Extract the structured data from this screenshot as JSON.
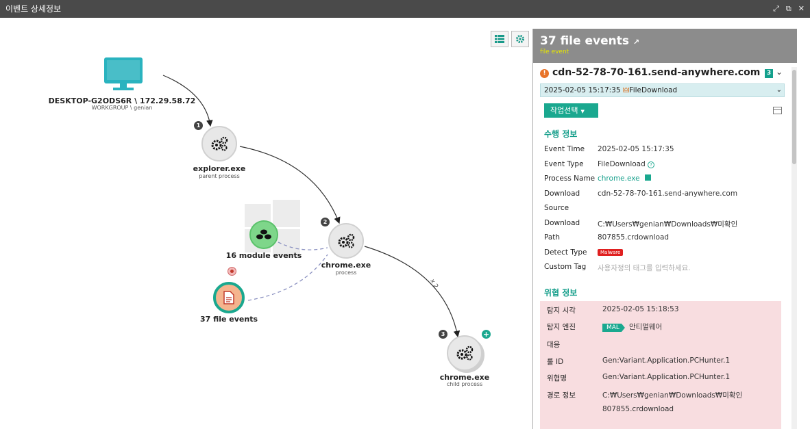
{
  "window": {
    "title": "이벤트 상세정보"
  },
  "graph": {
    "host": {
      "name": "DESKTOP-G2ODS6R \\ 172.29.58.72",
      "sub": "WORKGROUP \\ genian"
    },
    "nodes": [
      {
        "step": "1",
        "name": "explorer.exe",
        "sub": "parent process"
      },
      {
        "step": "2",
        "name": "chrome.exe",
        "sub": "process"
      },
      {
        "step": "3",
        "name": "chrome.exe",
        "sub": "child process"
      }
    ],
    "module_events": "16 module events",
    "file_events": "37 file events",
    "edge_label": "x 2",
    "add_icon": "+"
  },
  "panel": {
    "title": "37 file events",
    "subtitle": "file event",
    "domain": "cdn-52-78-70-161.send-anywhere.com",
    "domain_count": "3",
    "selected_event": "2025-02-05 15:17:35 ",
    "selected_event_type": "FileDownload",
    "action_button": "작업선택",
    "exec_section": "수행 정보",
    "exec": [
      {
        "k": "Event Time",
        "v": "2025-02-05 15:17:35"
      },
      {
        "k": "Event Type",
        "v": "FileDownload"
      },
      {
        "k": "Process Name",
        "v": "chrome.exe"
      },
      {
        "k": "Download",
        "v": "cdn-52-78-70-161.send-anywhere.com"
      },
      {
        "k": "Source",
        "v": ""
      },
      {
        "k": "Download",
        "v": "C:₩Users₩genian₩Downloads₩미확인"
      },
      {
        "k": "Path",
        "v": "807855.crdownload"
      },
      {
        "k": "Detect Type",
        "v": "Malware"
      },
      {
        "k": "Custom Tag",
        "v": "사용자정의 태그를 입력하세요."
      }
    ],
    "threat_section": "위협 정보",
    "threat": [
      {
        "k": "탐지 시각",
        "v": "2025-02-05 15:18:53"
      },
      {
        "k": "탐지 엔진",
        "tag": "MAL",
        "v": "안티멀웨어"
      },
      {
        "k": "대응",
        "v": ""
      },
      {
        "k": "룰 ID",
        "v": "Gen:Variant.Application.PCHunter.1"
      },
      {
        "k": "위협명",
        "v": "Gen:Variant.Application.PCHunter.1"
      },
      {
        "k": "경로 정보",
        "v": "C:₩Users₩genian₩Downloads₩미확인"
      },
      {
        "k": "",
        "v": "807855.crdownload"
      }
    ]
  },
  "colors": {
    "accent": "#1aa88f",
    "monitor": "#2ab3bf",
    "malware": "#e02020"
  }
}
